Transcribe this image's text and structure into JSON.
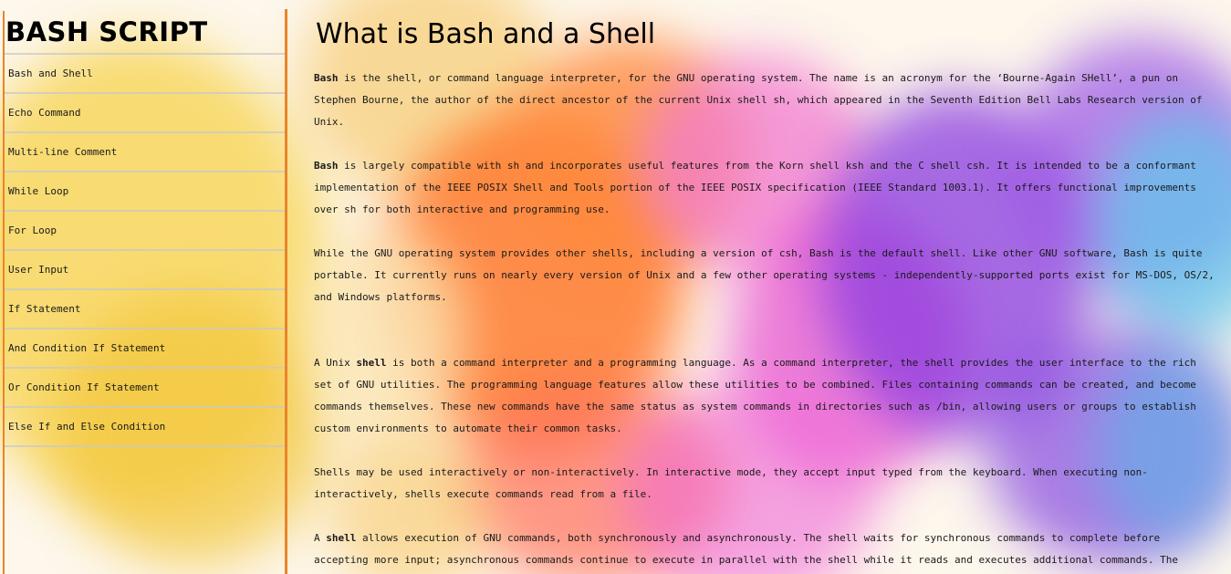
{
  "sidebar": {
    "title": "BASH SCRIPT",
    "items": [
      {
        "label": "Bash and Shell"
      },
      {
        "label": "Echo Command"
      },
      {
        "label": "Multi-line Comment"
      },
      {
        "label": "While Loop"
      },
      {
        "label": "For Loop"
      },
      {
        "label": "User Input"
      },
      {
        "label": "If Statement"
      },
      {
        "label": "And Condition If Statement"
      },
      {
        "label": "Or Condition If Statement"
      },
      {
        "label": "Else If and Else Condition"
      }
    ]
  },
  "main": {
    "title": "What is Bash and a Shell",
    "paragraphs": [
      {
        "lead": "Bash",
        "text": " is the shell, or command language interpreter, for the GNU operating system. The name is an acronym for the ‘Bourne-Again SHell’, a pun on Stephen Bourne, the author of the direct ancestor of the current Unix shell sh, which appeared in the Seventh Edition Bell Labs Research version of Unix."
      },
      {
        "lead": "Bash",
        "text": " is largely compatible with sh and incorporates useful features from the Korn shell ksh and the C shell csh. It is intended to be a conformant implementation of the IEEE POSIX Shell and Tools portion of the IEEE POSIX specification (IEEE Standard 1003.1). It offers functional improvements over sh for both interactive and programming use."
      },
      {
        "text": "While the GNU operating system provides other shells, including a version of csh, Bash is the default shell. Like other GNU software, Bash is quite portable. It currently runs on nearly every version of Unix and a few other operating systems - independently-supported ports exist for MS-DOS, OS/2, and Windows platforms."
      },
      {
        "pre": "A Unix ",
        "bold": "shell",
        "text": " is both a command interpreter and a programming language. As a command interpreter, the shell provides the user interface to the rich set of GNU utilities. The programming language features allow these utilities to be combined. Files containing commands can be created, and become commands themselves. These new commands have the same status as system commands in directories such as /bin, allowing users or groups to establish custom environments to automate their common tasks."
      },
      {
        "text": "Shells may be used interactively or non-interactively. In interactive mode, they accept input typed from the keyboard. When executing non-interactively, shells execute commands read from a file."
      },
      {
        "pre": "A ",
        "bold": "shell",
        "text": " allows execution of GNU commands, both synchronously and asynchronously. The shell waits for synchronous commands to complete before accepting more input; asynchronous commands continue to execute in parallel with the shell while it reads and executes additional commands. The redirection"
      }
    ]
  },
  "colors": {
    "accent": "#e8852a",
    "divider": "#c8c8c8"
  }
}
